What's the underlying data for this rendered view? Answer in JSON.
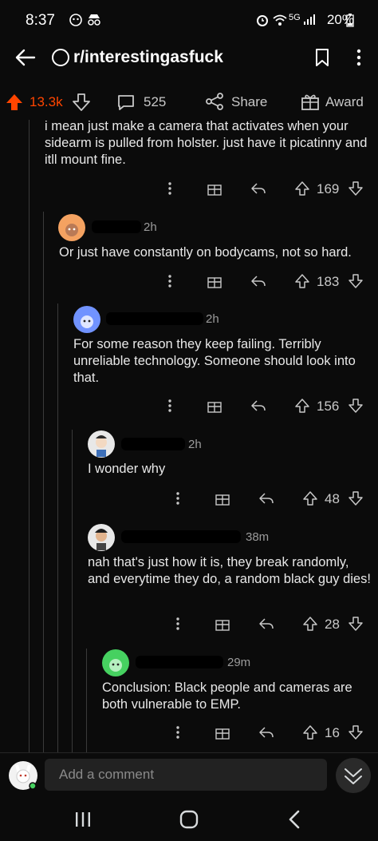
{
  "status_bar": {
    "time": "8:37",
    "battery": "20%"
  },
  "header": {
    "subreddit": "r/interestingasfuck"
  },
  "post_actions": {
    "score": "13.3k",
    "comments": "525",
    "share": "Share",
    "award": "Award"
  },
  "comments": [
    {
      "text": "i mean just make a camera that activates when your sidearm is pulled from holster. just have it picatinny and itll mount fine.",
      "votes": "169"
    },
    {
      "time": "2h",
      "text": "Or just have constantly on bodycams, not so hard.",
      "votes": "183"
    },
    {
      "time": "2h",
      "text": "For some reason they keep failing. Terribly unreliable technology. Someone should look into that.",
      "votes": "156"
    },
    {
      "time": "2h",
      "text": "I wonder why",
      "votes": "48"
    },
    {
      "time": "38m",
      "text": "nah that's just how it is, they break randomly, and everytime they do, a random black guy dies!",
      "votes": "28"
    },
    {
      "time": "29m",
      "text": "Conclusion: Black people and cameras are both vulnerable to EMP.",
      "votes": "16"
    }
  ],
  "composer": {
    "placeholder": "Add a comment"
  },
  "colors": {
    "upvote": "#ff4500",
    "background": "#0b0b0b",
    "text": "#d7dadc"
  }
}
